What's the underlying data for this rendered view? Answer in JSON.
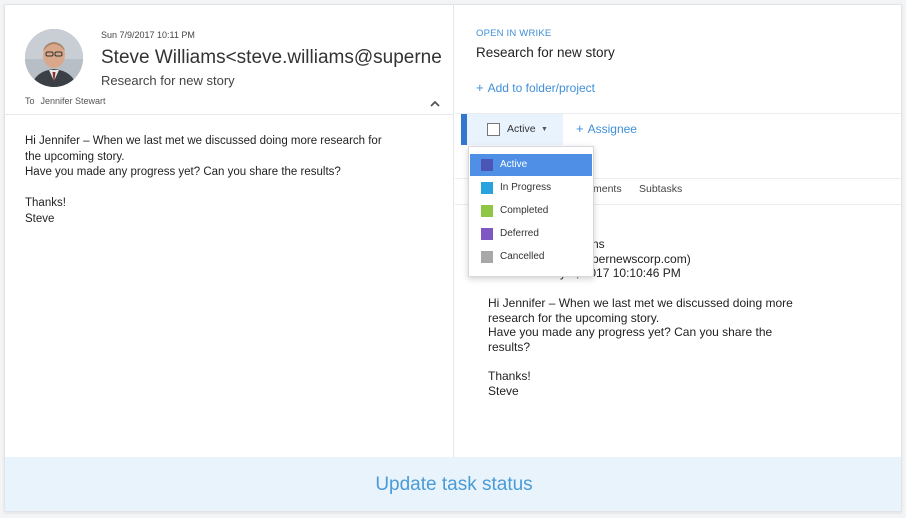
{
  "email": {
    "date": "Sun 7/9/2017 10:11 PM",
    "sender": "Steve Williams<steve.williams@supernewscorp.com>",
    "subject": "Research for new story",
    "to_label": "To",
    "to_name": "Jennifer Stewart",
    "body": [
      "Hi Jennifer – When we last met we discussed doing more research for",
      "the upcoming story.",
      "Have you made any progress yet? Can you share the results?",
      "",
      "Thanks!",
      "Steve"
    ],
    "collapse_icon": "chevron-up-icon"
  },
  "wrike": {
    "open_label": "OPEN IN WRIKE",
    "task_title": "Research for new story",
    "add_folder_label": "Add to folder/project",
    "status_label": "Active",
    "add_assignee_label": "Assignee",
    "tabs": [
      "ments",
      "Subtasks"
    ],
    "description": {
      "line1": "ns",
      "line2": "pernewscorp.com)",
      "received": "Recieved: July 9, 2017 10:10:46 PM",
      "body": [
        "Hi Jennifer – When we last met we discussed doing more",
        "research for the upcoming story.",
        "Have you made any progress yet? Can you share the",
        "results?",
        "",
        "Thanks!",
        "Steve"
      ]
    }
  },
  "status_dropdown": {
    "items": [
      {
        "label": "Active",
        "color": "#4a55b5",
        "selected": true
      },
      {
        "label": "In Progress",
        "color": "#29a3e0",
        "selected": false
      },
      {
        "label": "Completed",
        "color": "#8fc644",
        "selected": false
      },
      {
        "label": "Deferred",
        "color": "#7f57c2",
        "selected": false
      },
      {
        "label": "Cancelled",
        "color": "#a8a8a8",
        "selected": false
      }
    ]
  },
  "banner": {
    "text": "Update task status"
  },
  "colors": {
    "accent": "#3f8fd8",
    "selected_bg": "#4f8fe6",
    "banner_bg": "#e9f3fb",
    "banner_text": "#4a9bd6"
  }
}
